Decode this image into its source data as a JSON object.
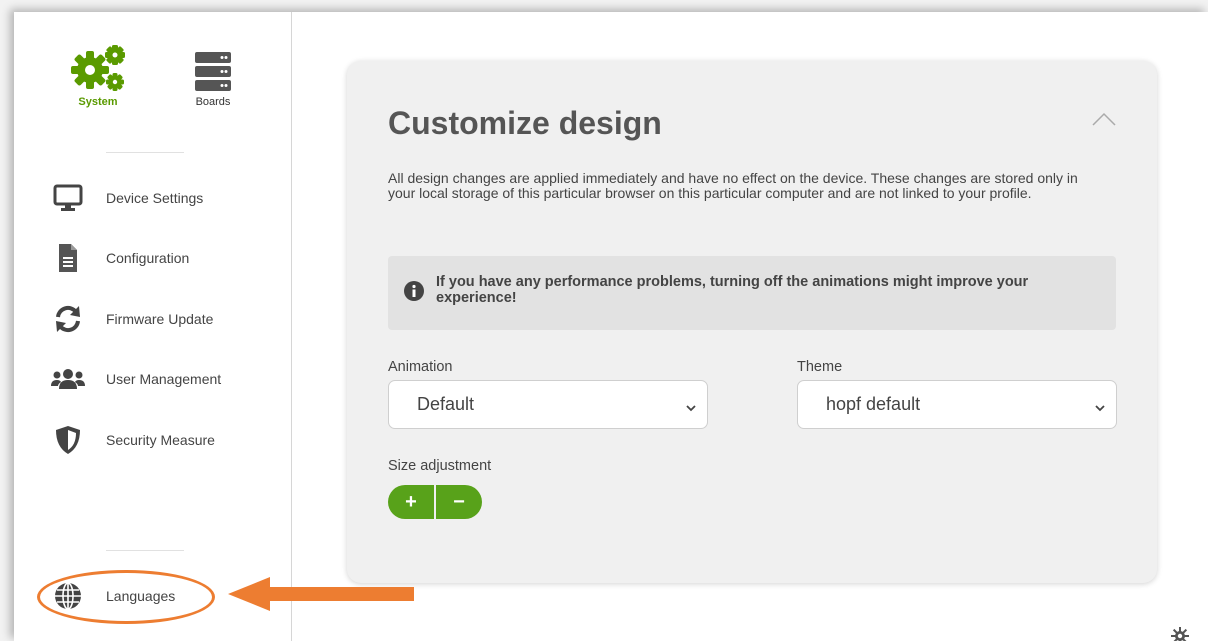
{
  "top_nav": {
    "system_label": "System",
    "boards_label": "Boards"
  },
  "sidebar": {
    "items": [
      {
        "label": "Device Settings",
        "icon": "monitor-icon"
      },
      {
        "label": "Configuration",
        "icon": "document-icon"
      },
      {
        "label": "Firmware Update",
        "icon": "refresh-icon"
      },
      {
        "label": "User Management",
        "icon": "users-icon"
      },
      {
        "label": "Security Measure",
        "icon": "shield-icon"
      }
    ],
    "languages_label": "Languages"
  },
  "card": {
    "title": "Customize design",
    "description": "All design changes are applied immediately and have no effect on the device. These changes are stored only in your local storage of this particular browser on this particular computer and are not linked to your profile.",
    "info": "If you have any performance problems, turning off the animations might improve your experience!",
    "animation_label": "Animation",
    "animation_value": "Default",
    "theme_label": "Theme",
    "theme_value": "hopf default",
    "size_label": "Size adjustment",
    "plus_label": "+",
    "minus_label": "−"
  },
  "colors": {
    "accent_green": "#58a21a",
    "annotation_orange": "#ed7d31"
  }
}
